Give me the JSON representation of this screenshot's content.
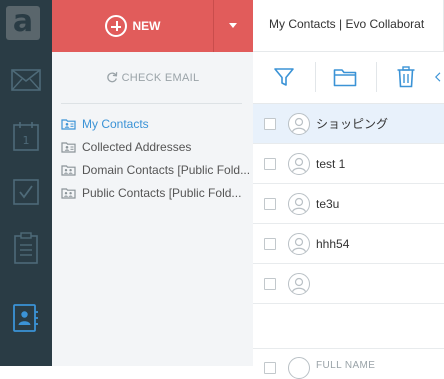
{
  "colors": {
    "rail_bg": "#2a3c45",
    "rail_icon": "#4e6a78",
    "rail_active_icon": "#3b93d6",
    "new_button_bg": "#e15c5b",
    "folder_panel_bg": "#f3f5f7",
    "selected_accent": "#3b93d6",
    "selected_row_bg": "#e8f1fb"
  },
  "rail": {
    "logo_glyph": "a",
    "items": [
      {
        "name": "mail",
        "icon": "envelope-icon"
      },
      {
        "name": "calendar",
        "icon": "calendar-icon",
        "day": "1"
      },
      {
        "name": "tasks",
        "icon": "checkbox-icon"
      },
      {
        "name": "notes",
        "icon": "notepad-icon"
      },
      {
        "name": "contacts",
        "icon": "contacts-book-icon",
        "active": true
      }
    ]
  },
  "new_button": {
    "label": "NEW",
    "icon": "plus-circle-icon",
    "dropdown_icon": "caret-down-icon"
  },
  "folders": {
    "check_email_label": "CHECK EMAIL",
    "items": [
      {
        "label": "My Contacts",
        "icon": "contact-folder-icon",
        "selected": true
      },
      {
        "label": "Collected Addresses",
        "icon": "contact-folder-icon"
      },
      {
        "label": "Domain Contacts [Public Fold...",
        "icon": "shared-contact-folder-icon"
      },
      {
        "label": "Public Contacts [Public Fold...",
        "icon": "shared-contact-folder-icon"
      }
    ]
  },
  "tab": {
    "title": "My Contacts | Evo Collaborat"
  },
  "toolbar": {
    "items": [
      "filter-icon",
      "folder-icon",
      "trash-icon"
    ]
  },
  "contacts": [
    {
      "name": "ショッピング",
      "selected": true
    },
    {
      "name": "test 1"
    },
    {
      "name": "te3u"
    },
    {
      "name": "hhh54"
    },
    {
      "name": ""
    }
  ],
  "list_footer": {
    "label": "FULL NAME"
  }
}
